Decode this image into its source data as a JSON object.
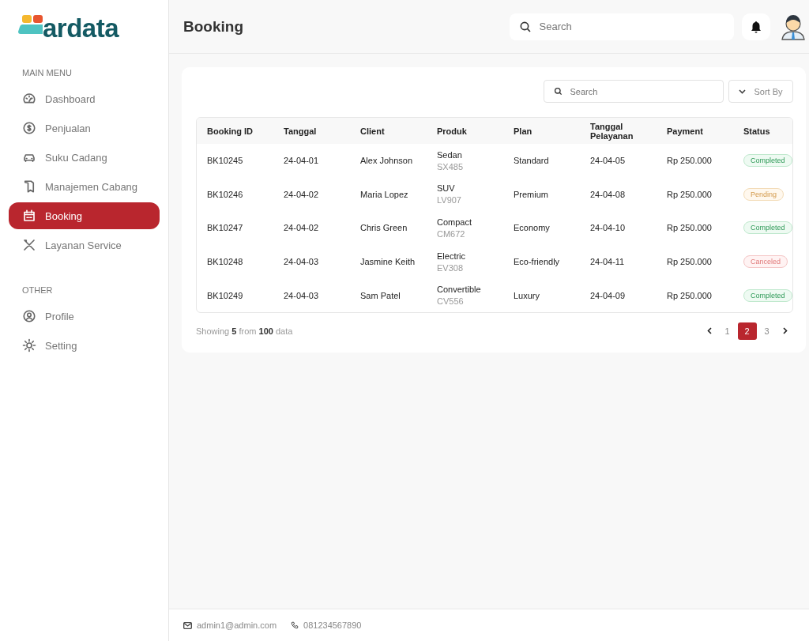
{
  "logo": {
    "text": "ardata"
  },
  "sidebar": {
    "sections": [
      {
        "title": "MAIN MENU",
        "items": [
          {
            "label": "Dashboard",
            "selected": false
          },
          {
            "label": "Penjualan",
            "selected": false
          },
          {
            "label": "Suku Cadang",
            "selected": false
          },
          {
            "label": "Manajemen Cabang",
            "selected": false
          },
          {
            "label": "Booking",
            "selected": true
          },
          {
            "label": "Layanan Service",
            "selected": false
          }
        ]
      },
      {
        "title": "OTHER",
        "items": [
          {
            "label": "Profile",
            "selected": false
          },
          {
            "label": "Setting",
            "selected": false
          }
        ]
      }
    ]
  },
  "header": {
    "title": "Booking",
    "search": {
      "placeholder": "Search"
    }
  },
  "toolbar": {
    "search": {
      "placeholder": "Search"
    },
    "sort": "Sort By"
  },
  "table": {
    "columns": [
      "Booking ID",
      "Tanggal",
      "Client",
      "Produk",
      "Plan",
      "Tanggal Pelayanan",
      "Payment",
      "Status"
    ],
    "rows": [
      {
        "id": "BK10245",
        "date": "24-04-01",
        "client": "Alex Johnson",
        "product": "Sedan",
        "code": "SX485",
        "plan": "Standard",
        "service_date": "24-04-05",
        "payment": "Rp 250.000",
        "status": "Completed",
        "kind": "completed"
      },
      {
        "id": "BK10246",
        "date": "24-04-02",
        "client": "Maria Lopez",
        "product": "SUV",
        "code": "LV907",
        "plan": "Premium",
        "service_date": "24-04-08",
        "payment": "Rp 250.000",
        "status": "Pending",
        "kind": "pending"
      },
      {
        "id": "BK10247",
        "date": "24-04-02",
        "client": "Chris Green",
        "product": "Compact",
        "code": "CM672",
        "plan": "Economy",
        "service_date": "24-04-10",
        "payment": "Rp 250.000",
        "status": "Completed",
        "kind": "completed"
      },
      {
        "id": "BK10248",
        "date": "24-04-03",
        "client": "Jasmine Keith",
        "product": "Electric",
        "code": "EV308",
        "plan": "Eco-friendly",
        "service_date": "24-04-11",
        "payment": "Rp 250.000",
        "status": "Canceled",
        "kind": "canceled"
      },
      {
        "id": "BK10249",
        "date": "24-04-03",
        "client": "Sam Patel",
        "product": "Convertible",
        "code": "CV556",
        "plan": "Luxury",
        "service_date": "24-04-09",
        "payment": "Rp 250.000",
        "status": "Completed",
        "kind": "completed"
      }
    ]
  },
  "summary": "Showing **5** from **100** data",
  "pagination": {
    "pages": [
      {
        "label": "1",
        "selected": false
      },
      {
        "label": "2",
        "selected": true
      },
      {
        "label": "3",
        "selected": false
      }
    ]
  },
  "footer": {
    "email": "admin1@admin.com",
    "phone": "081234567890"
  }
}
